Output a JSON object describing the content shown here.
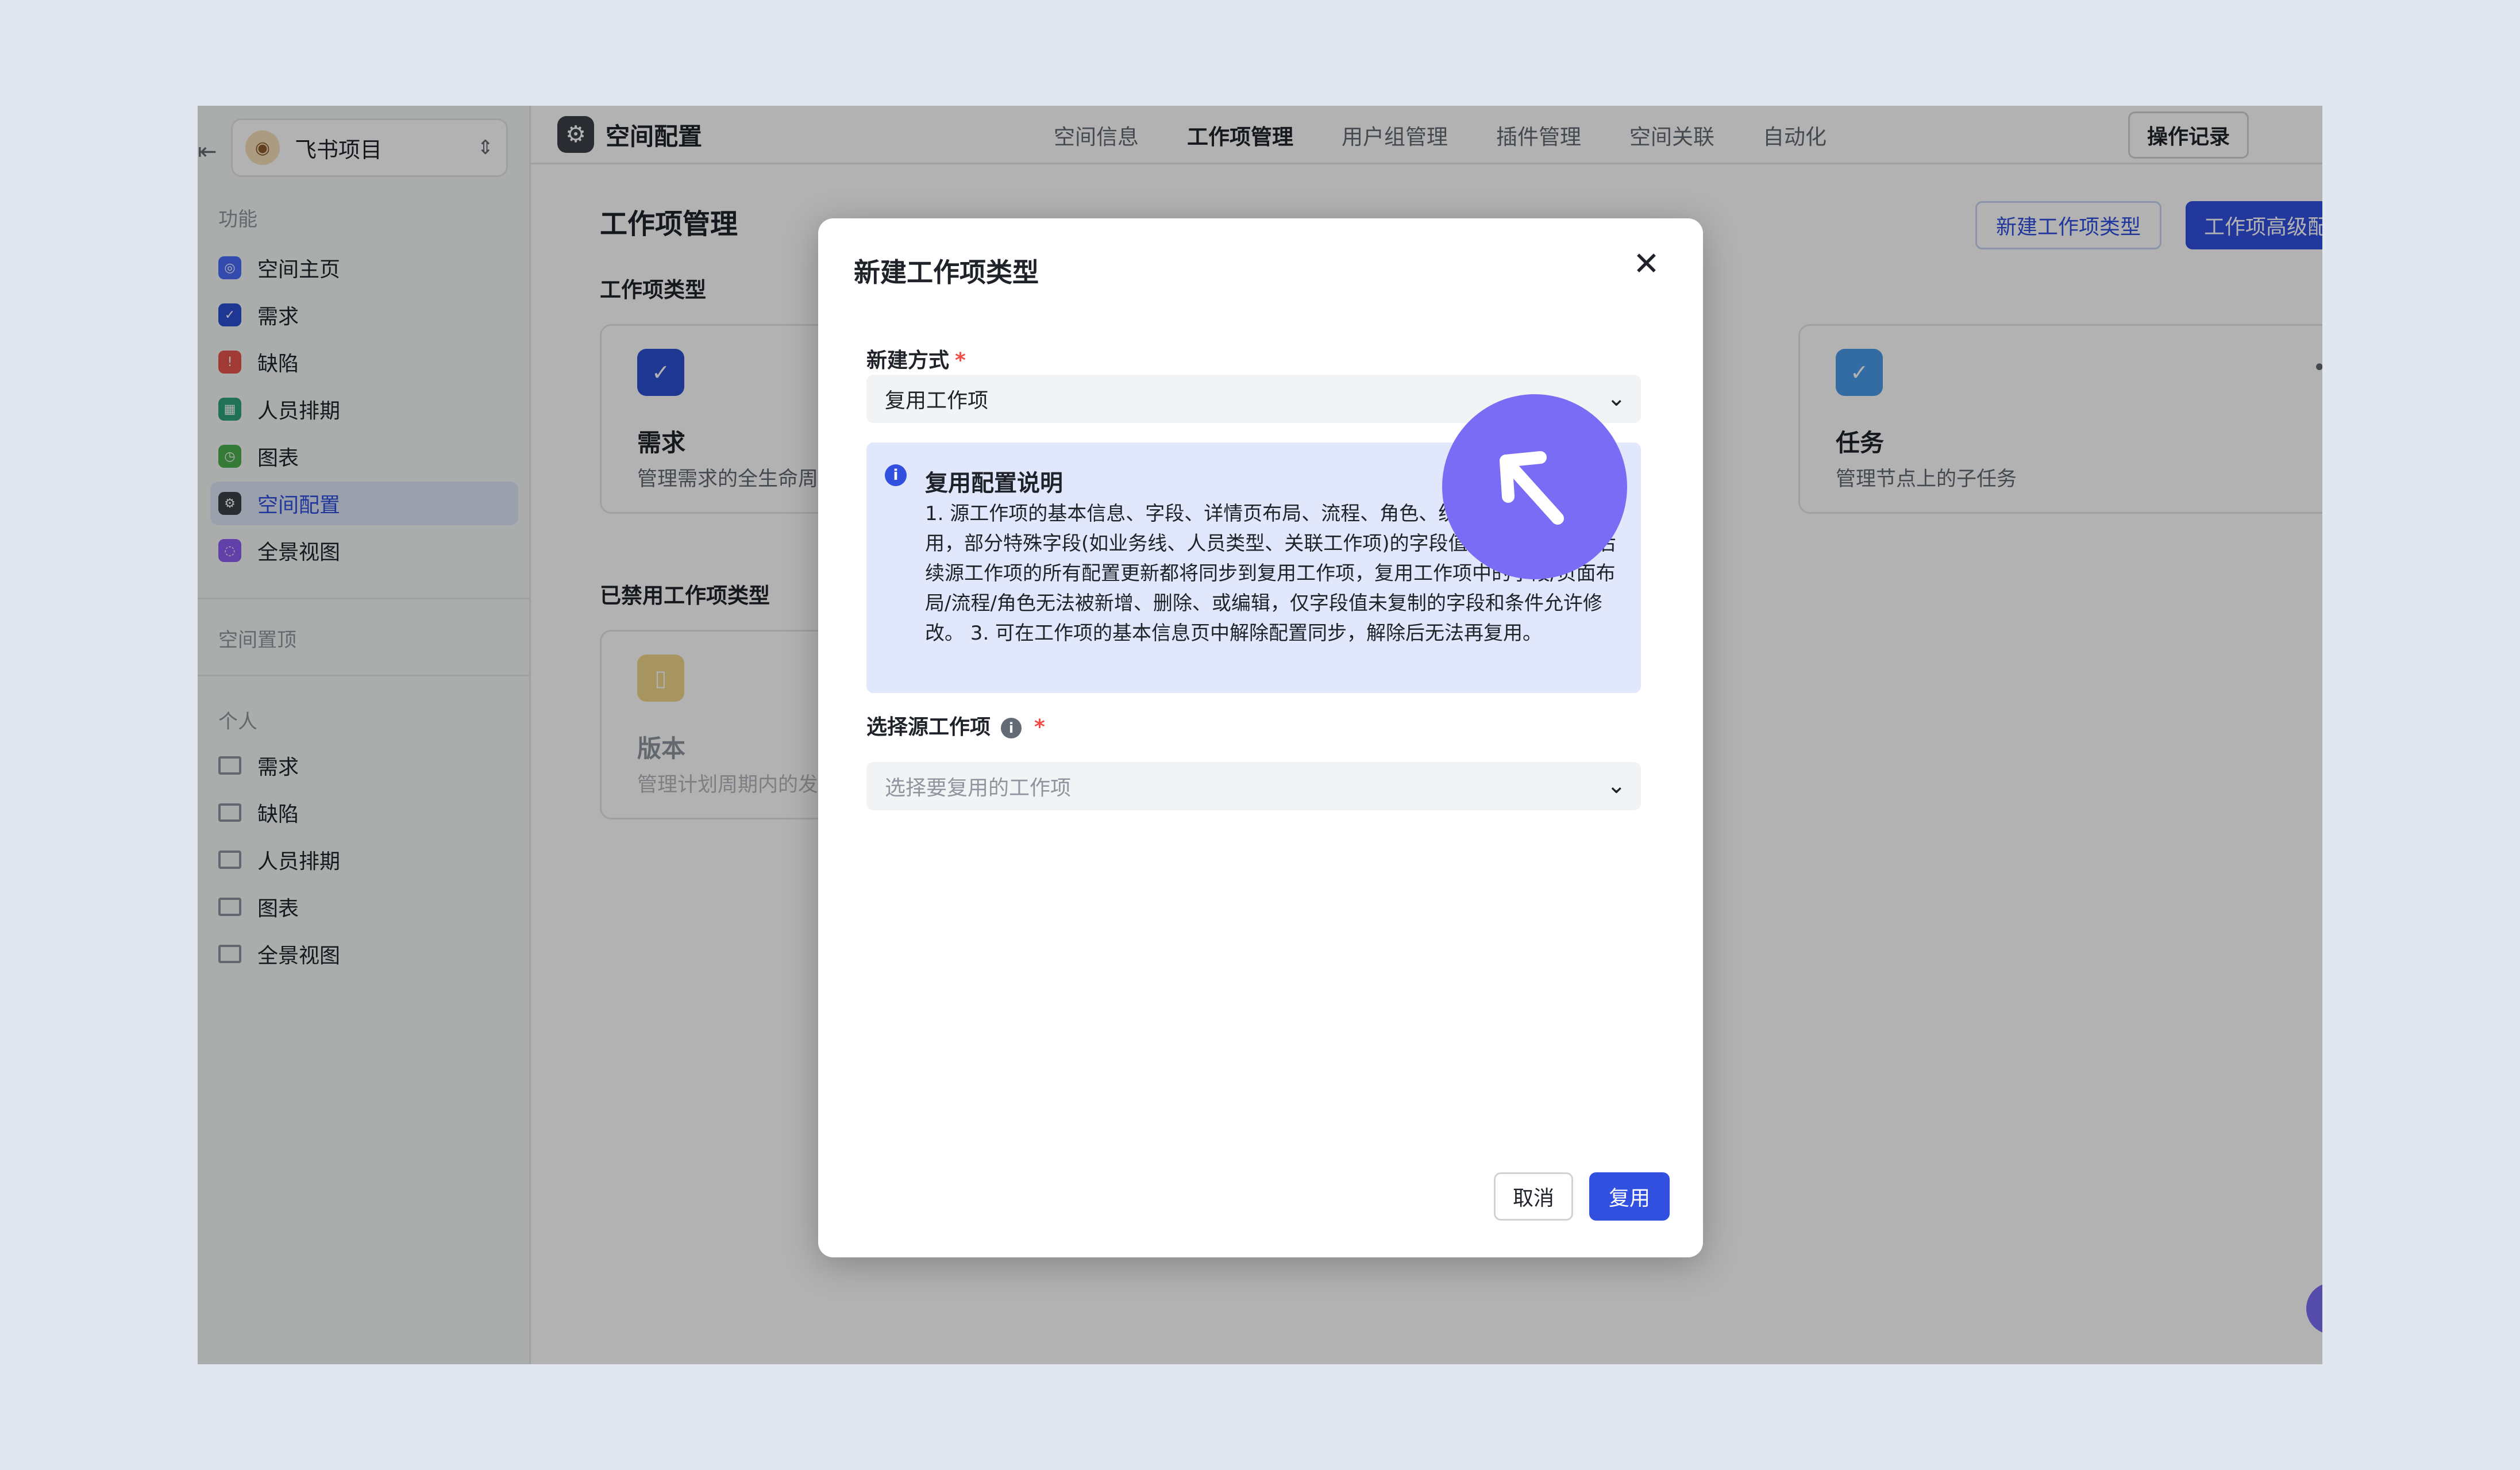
{
  "sidebar": {
    "project_name": "飞书项目",
    "section_function": "功能",
    "function_items": [
      {
        "label": "空间主页",
        "color": "#4a6cf7"
      },
      {
        "label": "需求",
        "color": "#2b4fd1"
      },
      {
        "label": "缺陷",
        "color": "#e5534b"
      },
      {
        "label": "人员排期",
        "color": "#2ea37a"
      },
      {
        "label": "图表",
        "color": "#4caf50"
      },
      {
        "label": "空间配置",
        "color": "#3b3f46"
      },
      {
        "label": "全景视图",
        "color": "#8c5cf0"
      }
    ],
    "section_pinned": "空间置顶",
    "section_personal": "个人",
    "personal_items": [
      {
        "label": "需求"
      },
      {
        "label": "缺陷"
      },
      {
        "label": "人员排期"
      },
      {
        "label": "图表"
      },
      {
        "label": "全景视图"
      }
    ]
  },
  "topbar": {
    "title": "空间配置",
    "tabs": [
      "空间信息",
      "工作项管理",
      "用户组管理",
      "插件管理",
      "空间关联",
      "自动化"
    ],
    "active_tab": "工作项管理",
    "log_button": "操作记录"
  },
  "main": {
    "title": "工作项管理",
    "new_type_button": "新建工作项类型",
    "advanced_button": "工作项高级配置",
    "types_title": "工作项类型",
    "disabled_title": "已禁用工作项类型",
    "cards": [
      {
        "name": "需求",
        "desc": "管理需求的全生命周期",
        "color": "#2b4fd1"
      },
      {
        "name": "任务",
        "desc": "管理节点上的子任务",
        "color": "#4a9be8"
      }
    ],
    "disabled_cards": [
      {
        "name": "版本",
        "desc": "管理计划周期内的发布",
        "color": "#e8c04a"
      }
    ]
  },
  "modal": {
    "title": "新建工作项类型",
    "method_label": "新建方式",
    "method_value": "复用工作项",
    "note_title": "复用配置说明",
    "note_body": "1. 源工作项的基本信息、字段、详情页布局、流程、角色、统计和关系均会被复用，部分特殊字段(如业务线、人员类型、关联工作项)的字段值不会被复用 2. 后续源工作项的所有配置更新都将同步到复用工作项，复用工作项中的字段/页面布局/流程/角色无法被新增、删除、或编辑，仅字段值未复制的字段和条件允许修改。 3. 可在工作项的基本信息页中解除配置同步，解除后无法再复用。",
    "source_label": "选择源工作项",
    "source_placeholder": "选择要复用的工作项",
    "cancel_button": "取消",
    "confirm_button": "复用"
  },
  "colors": {
    "accent": "#3250e0",
    "cursor_badge": "#7a6cf4",
    "note_bg": "#e1e8fc"
  }
}
